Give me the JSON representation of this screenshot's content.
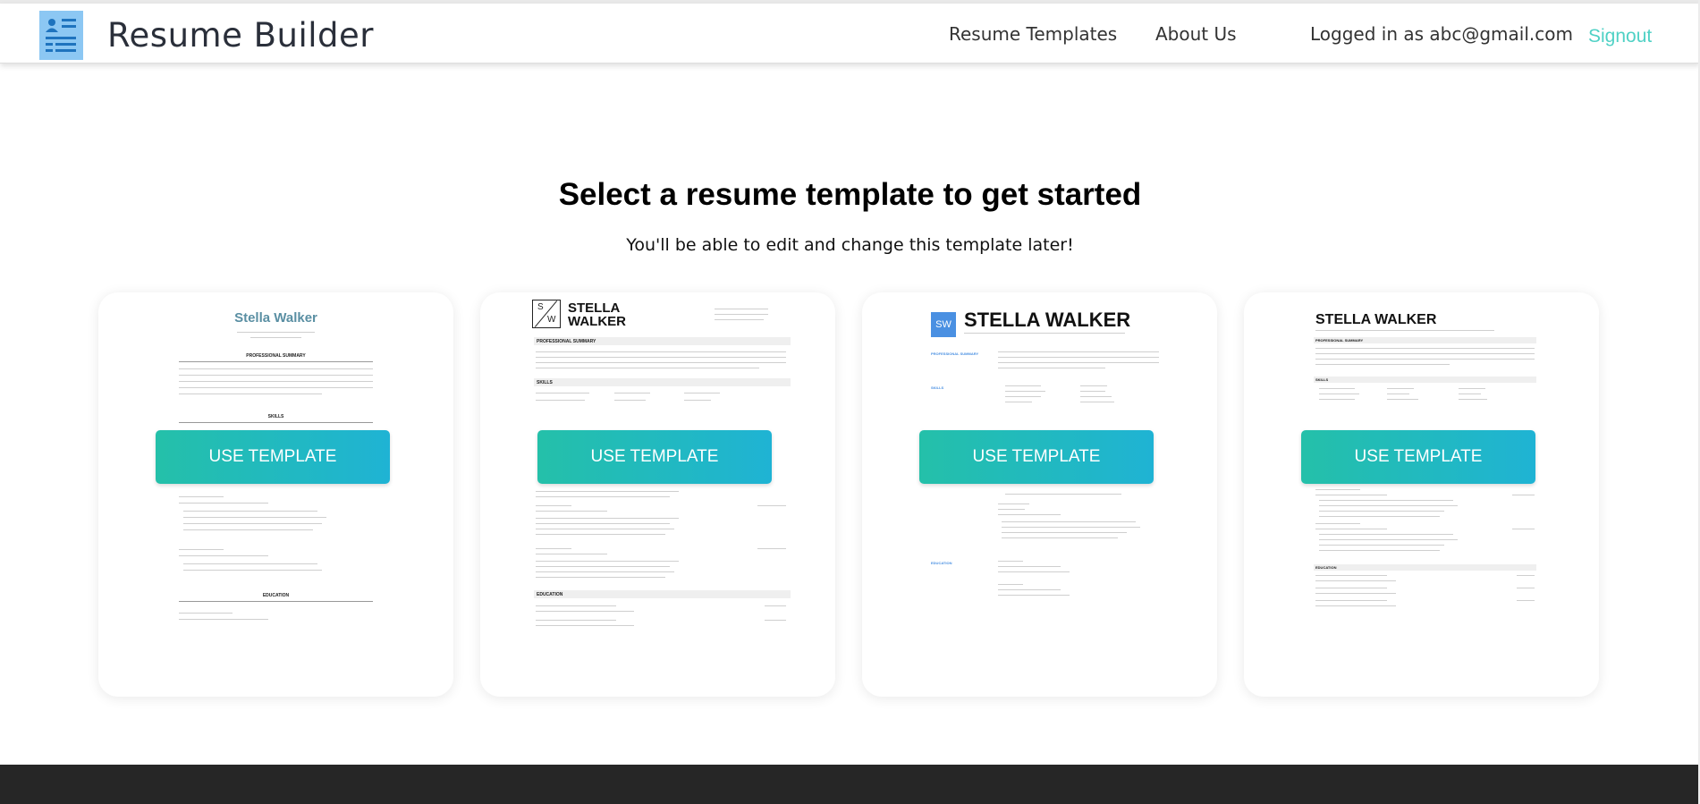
{
  "app": {
    "brand": "Resume Builder",
    "logo_icon": "document-list-icon"
  },
  "nav": {
    "templates": "Resume Templates",
    "about": "About Us",
    "user_status": "Logged in as abc@gmail.com",
    "signout": "Signout"
  },
  "main": {
    "heading": "Select a resume template to get started",
    "subheading": "You'll be able to edit and change this template later!"
  },
  "templates": [
    {
      "button": "USE TEMPLATE",
      "name": "Stella Walker",
      "sections": [
        "PROFESSIONAL SUMMARY",
        "SKILLS",
        "EDUCATION"
      ]
    },
    {
      "button": "USE TEMPLATE",
      "name_line1": "STELLA",
      "name_line2": "WALKER",
      "monogram_top": "S",
      "monogram_bottom": "W",
      "sections": [
        "PROFESSIONAL SUMMARY",
        "SKILLS",
        "EDUCATION"
      ]
    },
    {
      "button": "USE TEMPLATE",
      "name": "STELLA WALKER",
      "monogram": "SW",
      "sections": [
        "PROFESSIONAL SUMMARY",
        "SKILLS",
        "EDUCATION"
      ]
    },
    {
      "button": "USE TEMPLATE",
      "name": "STELLA WALKER",
      "sections": [
        "PROFESSIONAL SUMMARY",
        "SKILLS",
        "EDUCATION"
      ]
    }
  ],
  "colors": {
    "accent": "#4fd1c5",
    "button_start": "#24c0a9",
    "button_end": "#1fb3d4",
    "template1_name": "#5a8fa3",
    "template3_badge": "#4a90e2",
    "footer": "#262626"
  }
}
